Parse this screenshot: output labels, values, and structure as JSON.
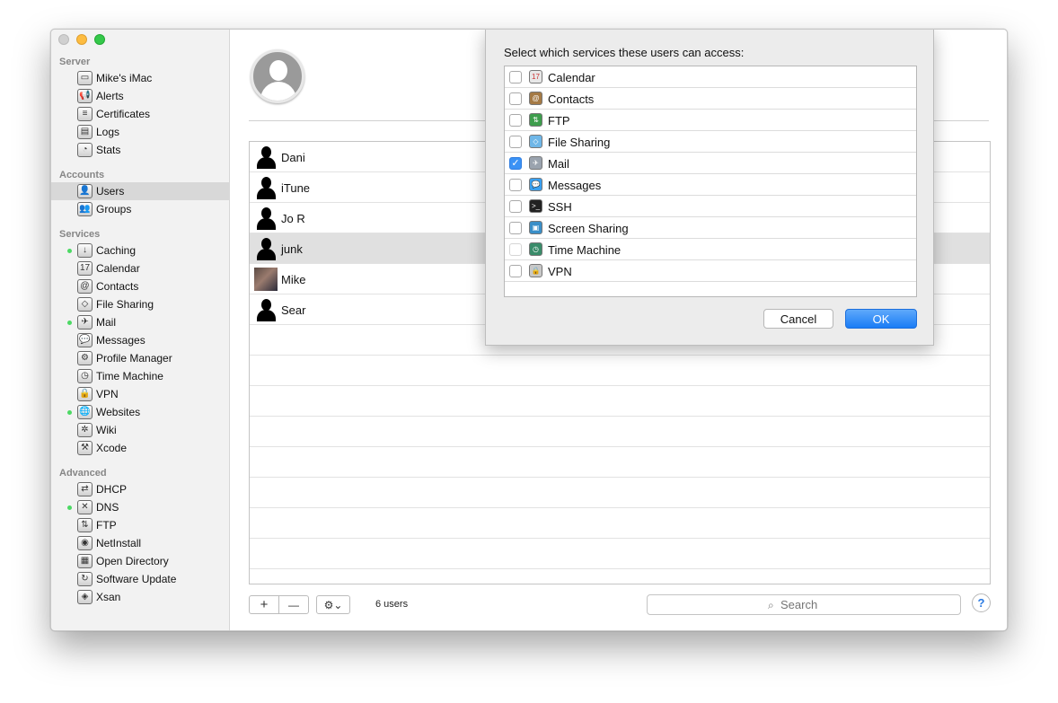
{
  "sidebar": {
    "sections": [
      {
        "title": "Server",
        "items": [
          {
            "label": "Mike's iMac",
            "icon": "imac-icon",
            "glyph": "▭",
            "dot": false
          },
          {
            "label": "Alerts",
            "icon": "megaphone-icon",
            "glyph": "📢",
            "dot": false
          },
          {
            "label": "Certificates",
            "icon": "certificate-icon",
            "glyph": "≡",
            "dot": false
          },
          {
            "label": "Logs",
            "icon": "logs-icon",
            "glyph": "▤",
            "dot": false
          },
          {
            "label": "Stats",
            "icon": "stats-icon",
            "glyph": "◔",
            "dot": false
          }
        ]
      },
      {
        "title": "Accounts",
        "items": [
          {
            "label": "Users",
            "icon": "user-icon",
            "glyph": "👤",
            "dot": false,
            "selected": true
          },
          {
            "label": "Groups",
            "icon": "group-icon",
            "glyph": "👥",
            "dot": false
          }
        ]
      },
      {
        "title": "Services",
        "items": [
          {
            "label": "Caching",
            "icon": "caching-icon",
            "glyph": "↓",
            "dot": true
          },
          {
            "label": "Calendar",
            "icon": "calendar-icon",
            "glyph": "17",
            "dot": false
          },
          {
            "label": "Contacts",
            "icon": "contacts-icon",
            "glyph": "@",
            "dot": false
          },
          {
            "label": "File Sharing",
            "icon": "file-sharing-icon",
            "glyph": "◇",
            "dot": false
          },
          {
            "label": "Mail",
            "icon": "mail-icon",
            "glyph": "✈",
            "dot": true
          },
          {
            "label": "Messages",
            "icon": "messages-icon",
            "glyph": "💬",
            "dot": false
          },
          {
            "label": "Profile Manager",
            "icon": "profile-manager-icon",
            "glyph": "⚙",
            "dot": false
          },
          {
            "label": "Time Machine",
            "icon": "time-machine-icon",
            "glyph": "◷",
            "dot": false
          },
          {
            "label": "VPN",
            "icon": "vpn-lock-icon",
            "glyph": "🔒",
            "dot": false
          },
          {
            "label": "Websites",
            "icon": "websites-globe-icon",
            "glyph": "🌐",
            "dot": true
          },
          {
            "label": "Wiki",
            "icon": "wiki-icon",
            "glyph": "✲",
            "dot": false
          },
          {
            "label": "Xcode",
            "icon": "xcode-hammer-icon",
            "glyph": "⚒",
            "dot": false
          }
        ]
      },
      {
        "title": "Advanced",
        "items": [
          {
            "label": "DHCP",
            "icon": "dhcp-icon",
            "glyph": "⇄",
            "dot": false
          },
          {
            "label": "DNS",
            "icon": "dns-icon",
            "glyph": "✕",
            "dot": true
          },
          {
            "label": "FTP",
            "icon": "ftp-icon",
            "glyph": "⇅",
            "dot": false
          },
          {
            "label": "NetInstall",
            "icon": "netinstall-icon",
            "glyph": "◉",
            "dot": false
          },
          {
            "label": "Open Directory",
            "icon": "open-directory-icon",
            "glyph": "▦",
            "dot": false
          },
          {
            "label": "Software Update",
            "icon": "software-update-icon",
            "glyph": "↻",
            "dot": false
          },
          {
            "label": "Xsan",
            "icon": "xsan-icon",
            "glyph": "◈",
            "dot": false
          }
        ]
      }
    ]
  },
  "users": [
    {
      "name": "Dani",
      "photo": false,
      "selected": false
    },
    {
      "name": "iTune",
      "photo": false,
      "selected": false
    },
    {
      "name": "Jo R",
      "photo": false,
      "selected": false
    },
    {
      "name": "junk",
      "photo": false,
      "selected": true
    },
    {
      "name": "Mike",
      "photo": true,
      "selected": false
    },
    {
      "name": "Sear",
      "photo": false,
      "selected": false
    }
  ],
  "bottom": {
    "add": "+",
    "remove": "—",
    "gear": "⚙︎⌄",
    "count": "6 users",
    "search_placeholder": "Search",
    "help": "?"
  },
  "sheet": {
    "title": "Select which services these users can access:",
    "services": [
      {
        "label": "Calendar",
        "checked": false,
        "icon": "calendar-icon",
        "color": "#e8e8e8",
        "glyph": "17"
      },
      {
        "label": "Contacts",
        "checked": false,
        "icon": "contacts-icon",
        "color": "#a57a45",
        "glyph": "@"
      },
      {
        "label": "FTP",
        "checked": false,
        "icon": "ftp-icon",
        "color": "#3d9d4c",
        "glyph": "⇅"
      },
      {
        "label": "File Sharing",
        "checked": false,
        "icon": "file-sharing-icon",
        "color": "#6fb7e8",
        "glyph": "◇"
      },
      {
        "label": "Mail",
        "checked": true,
        "icon": "mail-icon",
        "color": "#9aa3ae",
        "glyph": "✈"
      },
      {
        "label": "Messages",
        "checked": false,
        "icon": "messages-icon",
        "color": "#3aa0f0",
        "glyph": "💬"
      },
      {
        "label": "SSH",
        "checked": false,
        "icon": "ssh-terminal-icon",
        "color": "#222222",
        "glyph": ">_"
      },
      {
        "label": "Screen Sharing",
        "checked": false,
        "icon": "screen-sharing-icon",
        "color": "#3a8fc8",
        "glyph": "▣"
      },
      {
        "label": "Time Machine",
        "checked": false,
        "icon": "time-machine-icon",
        "color": "#3a8c6a",
        "glyph": "◷",
        "dim": true
      },
      {
        "label": "VPN",
        "checked": false,
        "icon": "vpn-lock-icon",
        "color": "#c8c8c8",
        "glyph": "🔒"
      }
    ],
    "cancel": "Cancel",
    "ok": "OK"
  }
}
